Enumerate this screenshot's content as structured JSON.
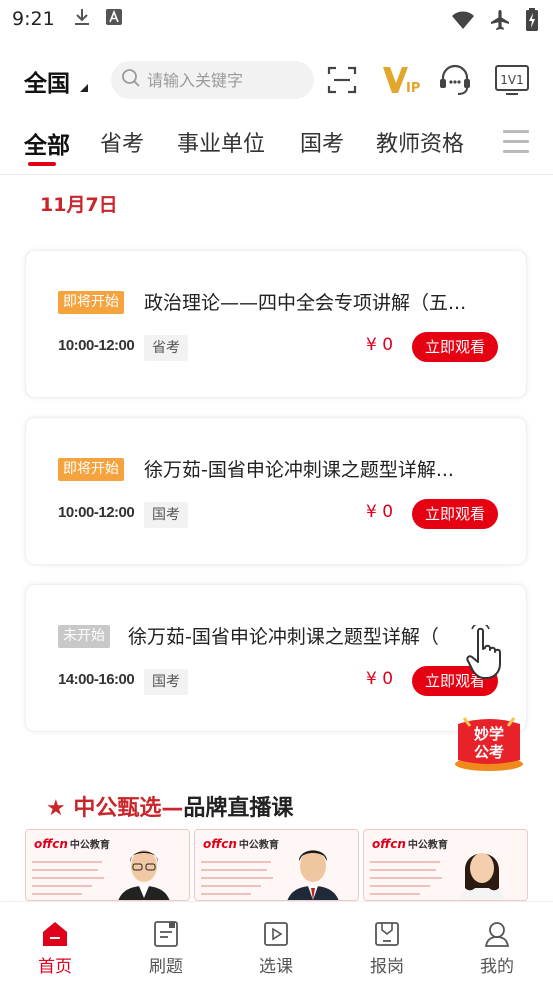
{
  "status_bar": {
    "time": "9:21"
  },
  "header": {
    "region": "全国",
    "search_placeholder": "请输入关键字",
    "icons": [
      "scan-icon",
      "vip-icon",
      "customer-service-icon",
      "one-on-one-icon"
    ],
    "vip_label": "VIP",
    "one_on_one_label": "1V1"
  },
  "tabs": [
    {
      "label": "全部",
      "active": true
    },
    {
      "label": "省考"
    },
    {
      "label": "事业单位"
    },
    {
      "label": "国考"
    },
    {
      "label": "教师资格"
    }
  ],
  "date_label": "11月7日",
  "courses": [
    {
      "badge": "即将开始",
      "title": "政治理论——四中全会专项讲解（五...",
      "time": "10:00-12:00",
      "tag": "省考",
      "price": "¥ 0",
      "button": "立即观看"
    },
    {
      "badge": "即将开始",
      "title": "徐万茹-国省申论冲刺课之题型详解...",
      "time": "10:00-12:00",
      "tag": "国考",
      "price": "¥ 0",
      "button": "立即观看"
    },
    {
      "badge": "未开始",
      "title": "徐万茹-国省申论冲刺课之题型详解（",
      "time": "14:00-16:00",
      "tag": "国考",
      "price": "¥ 0",
      "button": "立即观看"
    }
  ],
  "promo": {
    "line1": "妙学",
    "line2": "公考"
  },
  "brand_section": {
    "star": "★",
    "part1": "中公甄选",
    "dash": "—",
    "part2": "品牌直播课"
  },
  "brand_logo": {
    "latin": "offcn",
    "cn": "中公教育"
  },
  "bottom_nav": [
    {
      "label": "首页",
      "icon": "home-icon",
      "active": true
    },
    {
      "label": "刷题",
      "icon": "practice-icon"
    },
    {
      "label": "选课",
      "icon": "course-select-icon"
    },
    {
      "label": "报岗",
      "icon": "job-apply-icon"
    },
    {
      "label": "我的",
      "icon": "profile-icon"
    }
  ],
  "colors": {
    "accent": "#e0001b",
    "badge_soon": "#f5a33e",
    "badge_notstarted": "#c8c8c8",
    "date": "#c8262b"
  }
}
